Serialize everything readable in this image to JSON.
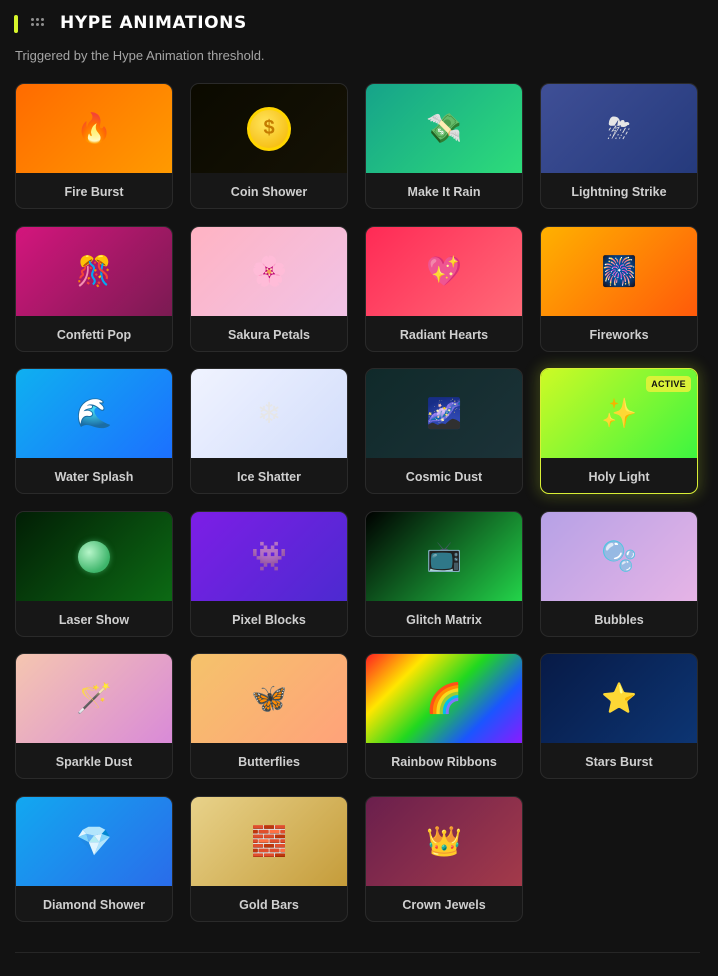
{
  "header": {
    "title": "HYPE ANIMATIONS",
    "subtitle": "Triggered by the Hype Animation threshold.",
    "accent_color": "#d7f52b"
  },
  "animations": [
    {
      "id": "fire-burst",
      "label": "Fire Burst",
      "icon": "fire-icon",
      "glyph": "🔥",
      "gradient": [
        "#ff6b00",
        "#ff9a00"
      ],
      "active": false
    },
    {
      "id": "coin-shower",
      "label": "Coin Shower",
      "icon": "coin-icon",
      "glyph": "$",
      "gradient": [
        "#0b0a00",
        "#151205"
      ],
      "active": false
    },
    {
      "id": "make-it-rain",
      "label": "Make It Rain",
      "icon": "money-icon",
      "glyph": "💸",
      "gradient": [
        "#16a38a",
        "#2ddc7a"
      ],
      "active": false
    },
    {
      "id": "lightning-strike",
      "label": "Lightning Strike",
      "icon": "storm-cloud-icon",
      "glyph": "⛈",
      "gradient": [
        "#3f4f96",
        "#253a7c"
      ],
      "active": false
    },
    {
      "id": "confetti-pop",
      "label": "Confetti Pop",
      "icon": "party-icon",
      "glyph": "🎊",
      "gradient": [
        "#d4157d",
        "#7a1b52"
      ],
      "active": false
    },
    {
      "id": "sakura-petals",
      "label": "Sakura Petals",
      "icon": "cherry-blossom-icon",
      "glyph": "🌸",
      "gradient": [
        "#ffb3c3",
        "#f1c3e6"
      ],
      "active": false
    },
    {
      "id": "radiant-hearts",
      "label": "Radiant Hearts",
      "icon": "sparkling-heart-icon",
      "glyph": "💖",
      "gradient": [
        "#ff2a55",
        "#ff6a78"
      ],
      "active": false
    },
    {
      "id": "fireworks",
      "label": "Fireworks",
      "icon": "fireworks-icon",
      "glyph": "🎆",
      "gradient": [
        "#ffb100",
        "#ff5a0a"
      ],
      "active": false
    },
    {
      "id": "water-splash",
      "label": "Water Splash",
      "icon": "water-wave-icon",
      "glyph": "🌊",
      "gradient": [
        "#0fb0f0",
        "#1c70ff"
      ],
      "active": false
    },
    {
      "id": "ice-shatter",
      "label": "Ice Shatter",
      "icon": "snowflake-icon",
      "glyph": "❄",
      "gradient": [
        "#f0f3ff",
        "#d2ddfb"
      ],
      "active": false
    },
    {
      "id": "cosmic-dust",
      "label": "Cosmic Dust",
      "icon": "milky-way-icon",
      "glyph": "🌌",
      "gradient": [
        "#102a2a",
        "#1c3238"
      ],
      "active": false
    },
    {
      "id": "holy-light",
      "label": "Holy Light",
      "icon": "sparkles-icon",
      "glyph": "✨",
      "gradient": [
        "#cdfa25",
        "#3df540"
      ],
      "active": true,
      "badge": "ACTIVE"
    },
    {
      "id": "laser-show",
      "label": "Laser Show",
      "icon": "green-orb-icon",
      "glyph": "",
      "gradient": [
        "#021e05",
        "#0c6a14"
      ],
      "active": false
    },
    {
      "id": "pixel-blocks",
      "label": "Pixel Blocks",
      "icon": "space-invader-icon",
      "glyph": "👾",
      "gradient": [
        "#7d1ee6",
        "#4c2ad0"
      ],
      "active": false
    },
    {
      "id": "glitch-matrix",
      "label": "Glitch Matrix",
      "icon": "television-icon",
      "glyph": "📺",
      "gradient": [
        "#000000",
        "#23d44a"
      ],
      "active": false
    },
    {
      "id": "bubbles",
      "label": "Bubbles",
      "icon": "bubbles-icon",
      "glyph": "🫧",
      "gradient": [
        "#b6a1e6",
        "#e6b4e6"
      ],
      "active": false
    },
    {
      "id": "sparkle-dust",
      "label": "Sparkle Dust",
      "icon": "magic-wand-icon",
      "glyph": "🪄",
      "gradient": [
        "#f5c6b0",
        "#d98ad8"
      ],
      "active": false
    },
    {
      "id": "butterflies",
      "label": "Butterflies",
      "icon": "butterfly-icon",
      "glyph": "🦋",
      "gradient": [
        "#f5c36b",
        "#ffa27a"
      ],
      "active": false
    },
    {
      "id": "rainbow-ribbons",
      "label": "Rainbow Ribbons",
      "icon": "rainbow-icon",
      "glyph": "🌈",
      "gradient": [
        "#ff2020",
        "#ffe600",
        "#20d820",
        "#1b55ff",
        "#8a1bff"
      ],
      "active": false
    },
    {
      "id": "stars-burst",
      "label": "Stars Burst",
      "icon": "star-icon",
      "glyph": "⭐",
      "gradient": [
        "#071a46",
        "#0d3573"
      ],
      "active": false
    },
    {
      "id": "diamond-shower",
      "label": "Diamond Shower",
      "icon": "gem-icon",
      "glyph": "💎",
      "gradient": [
        "#12a8f0",
        "#2a6cea"
      ],
      "active": false
    },
    {
      "id": "gold-bars",
      "label": "Gold Bars",
      "icon": "brick-icon",
      "glyph": "🧱",
      "gradient": [
        "#e8d28a",
        "#c59c3a"
      ],
      "active": false
    },
    {
      "id": "crown-jewels",
      "label": "Crown Jewels",
      "icon": "crown-icon",
      "glyph": "👑",
      "gradient": [
        "#6a1f4d",
        "#a33a4a"
      ],
      "active": false
    }
  ]
}
